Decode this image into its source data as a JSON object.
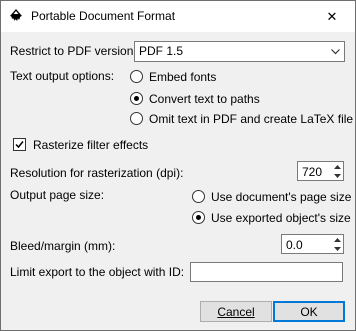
{
  "window": {
    "title": "Portable Document Format",
    "close_glyph": "✕"
  },
  "pdf_version": {
    "label": "Restrict to PDF version:",
    "selected": "PDF 1.5"
  },
  "text_output": {
    "label": "Text output options:",
    "options": [
      {
        "label": "Embed fonts",
        "selected": false
      },
      {
        "label": "Convert text to paths",
        "selected": true
      },
      {
        "label": "Omit text in PDF and create LaTeX file",
        "selected": false
      }
    ]
  },
  "rasterize": {
    "label": "Rasterize filter effects",
    "checked": true
  },
  "resolution": {
    "label": "Resolution for rasterization (dpi):",
    "value": "720"
  },
  "page_size": {
    "label": "Output page size:",
    "options": [
      {
        "label": "Use document's page size",
        "selected": false
      },
      {
        "label": "Use exported object's size",
        "selected": true
      }
    ]
  },
  "bleed": {
    "label": "Bleed/margin (mm):",
    "value": "0.0"
  },
  "limit_export": {
    "label": "Limit export to the object with ID:",
    "value": ""
  },
  "buttons": {
    "cancel": "Cancel",
    "ok": "OK"
  },
  "colors": {
    "dialog_bg": "#f0f0f0",
    "default_button_border": "#0078d7"
  }
}
